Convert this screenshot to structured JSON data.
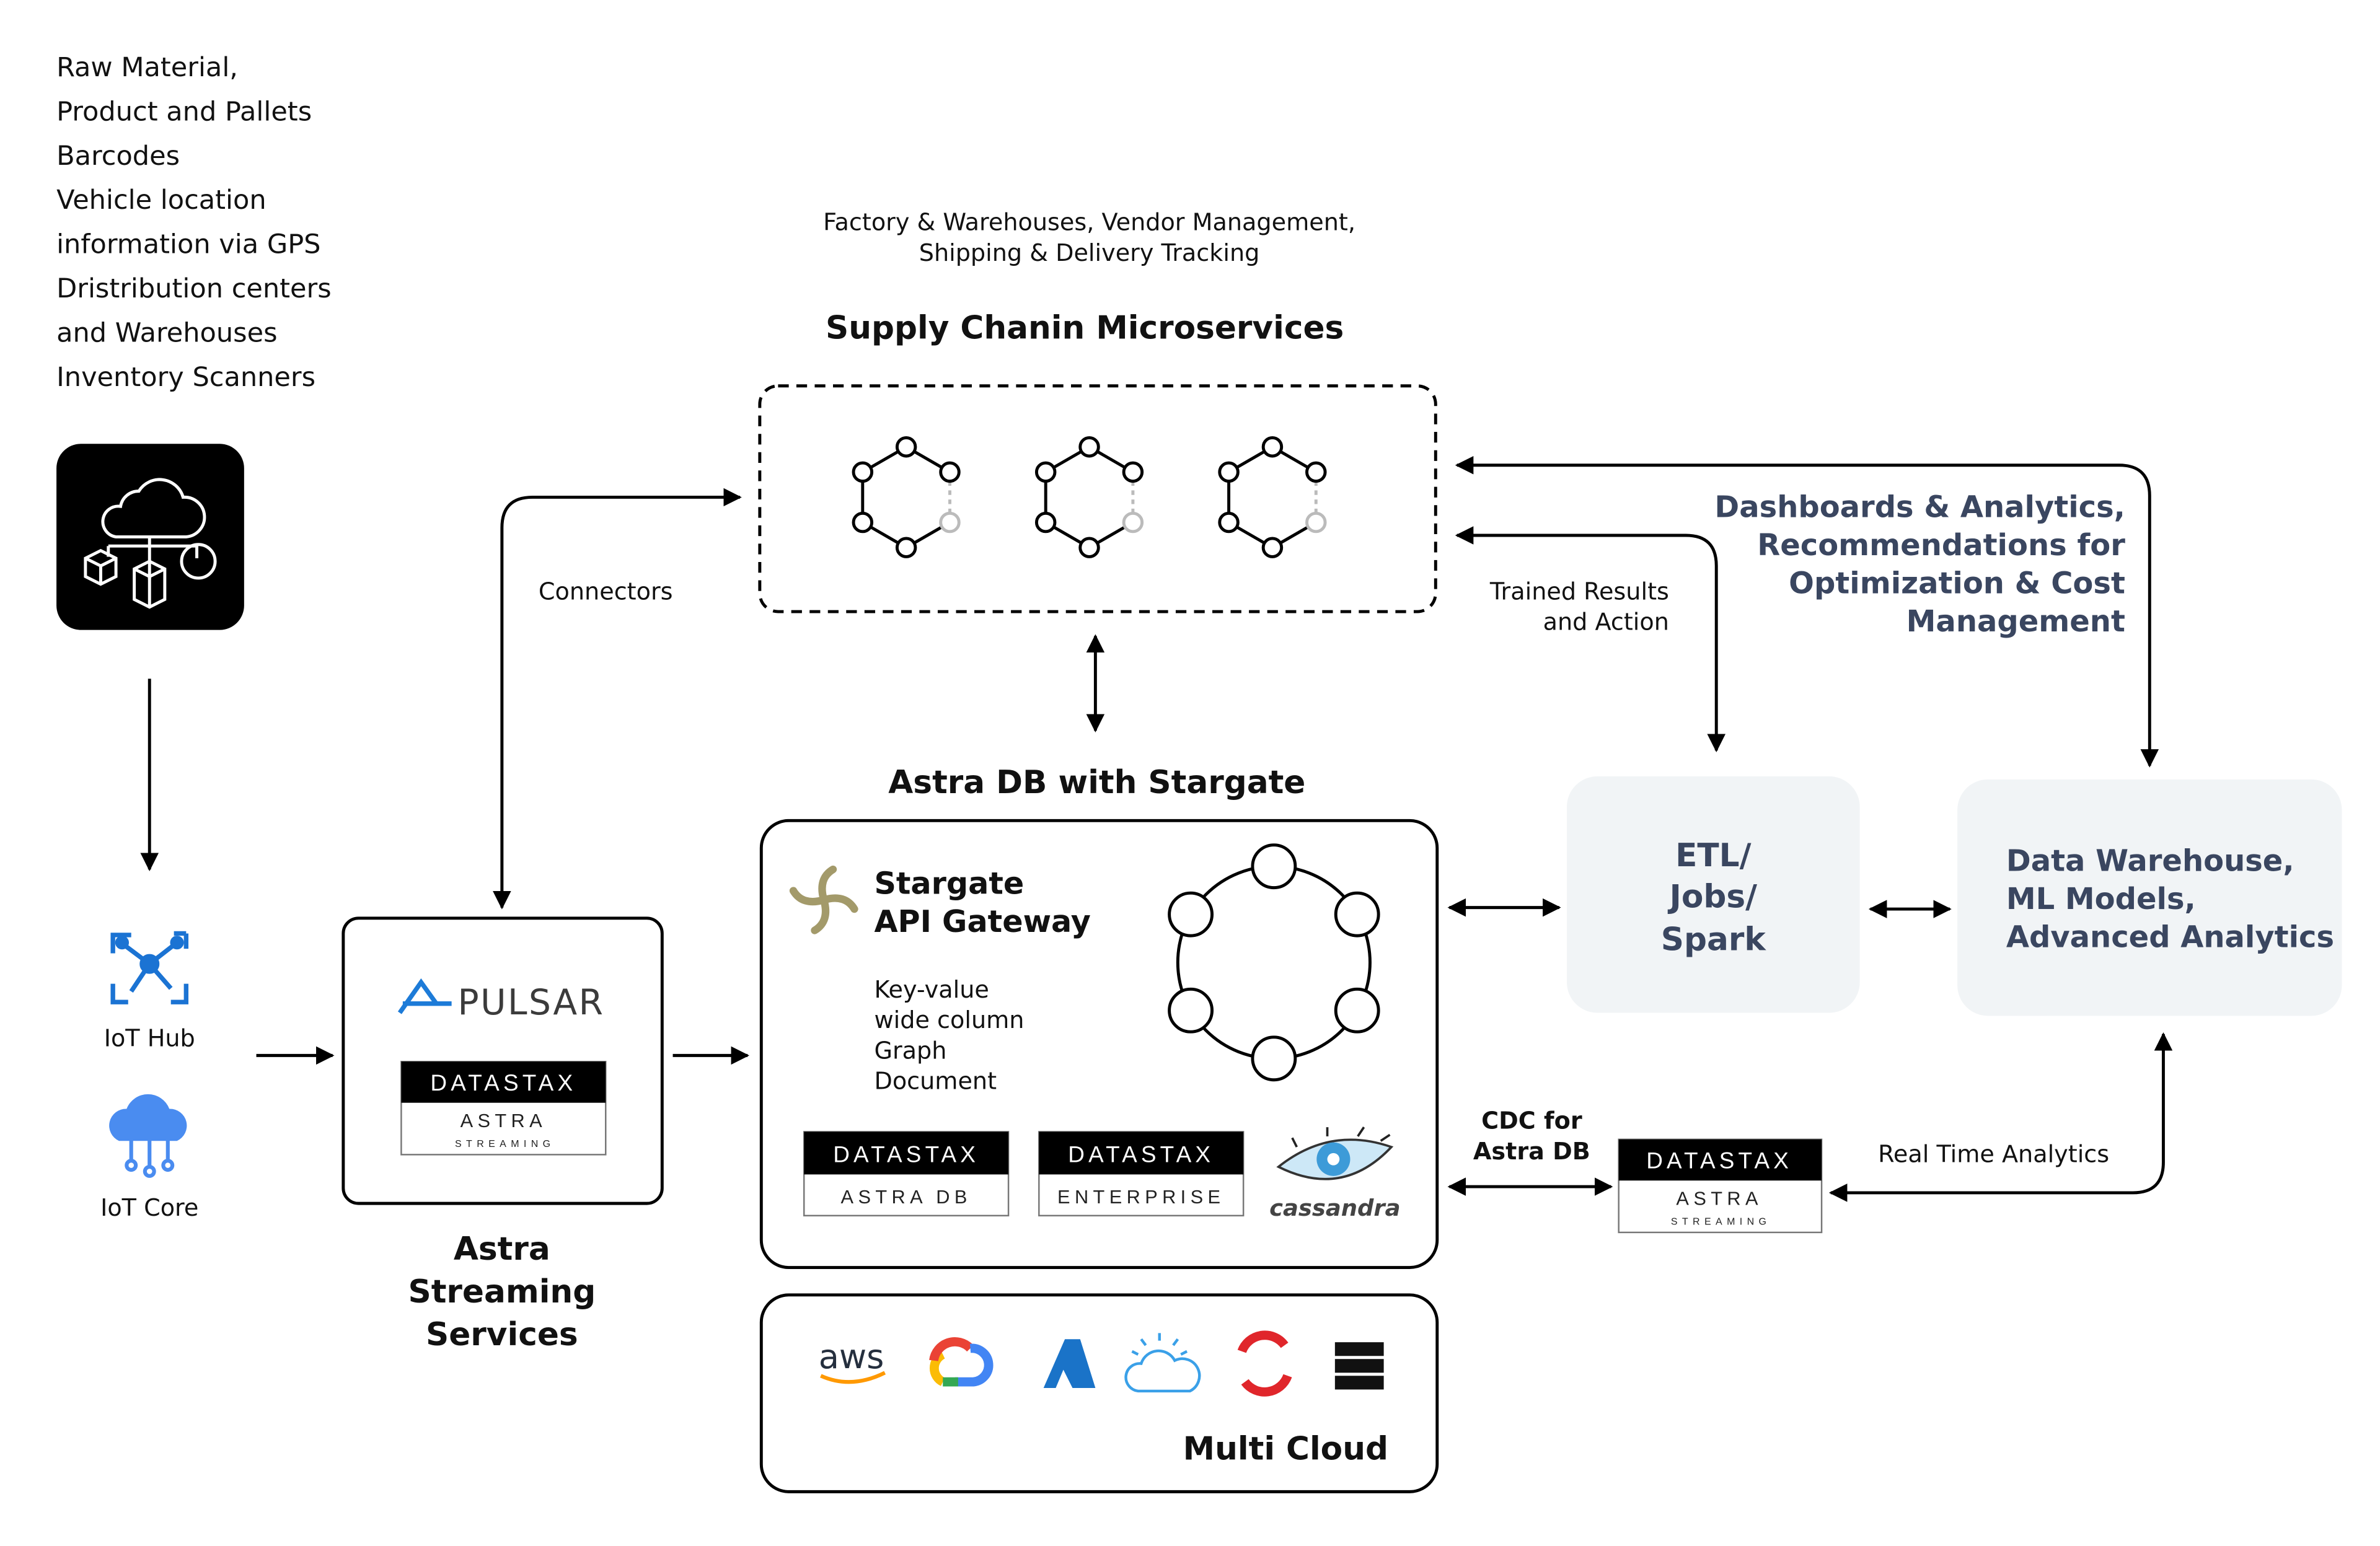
{
  "sources": {
    "lines": [
      "Raw Material,",
      "Product and Pallets",
      "Barcodes",
      "Vehicle location",
      "information via GPS",
      "Dristribution centers",
      "and Warehouses",
      "Inventory Scanners"
    ],
    "iot_hub_label": "IoT Hub",
    "iot_core_label": "IoT Core"
  },
  "streaming": {
    "pulsar_label": "PULSAR",
    "badge_brand": "DATASTAX",
    "badge_product": "ASTRA",
    "badge_sub": "STREAMING",
    "title_lines": [
      "Astra",
      "Streaming",
      "Services"
    ],
    "connectors_label": "Connectors"
  },
  "microservices": {
    "caption_lines": [
      "Factory & Warehouses, Vendor Management,",
      "Shipping & Delivery Tracking"
    ],
    "title": "Supply Chanin Microservices"
  },
  "astra_db": {
    "title": "Astra DB with Stargate",
    "gateway_lines": [
      "Stargate",
      "API Gateway"
    ],
    "models": [
      "Key-value",
      "wide column",
      "Graph",
      "Document"
    ],
    "badges": [
      {
        "brand": "DATASTAX",
        "product": "ASTRA DB"
      },
      {
        "brand": "DATASTAX",
        "product": "ENTERPRISE"
      }
    ],
    "cassandra_label": "cassandra"
  },
  "multi_cloud": {
    "title": "Multi Cloud",
    "aws_label": "aws",
    "icons": [
      "aws-icon",
      "google-cloud-icon",
      "azure-icon",
      "ibm-cloud-icon",
      "openshift-icon",
      "on-prem-server-icon"
    ]
  },
  "etl": {
    "lines": [
      "ETL/",
      "Jobs/",
      "Spark"
    ]
  },
  "warehouse": {
    "lines": [
      "Data Warehouse,",
      "ML Models,",
      "Advanced Analytics"
    ]
  },
  "flows": {
    "trained_lines": [
      "Trained Results",
      "and Action"
    ],
    "dashboards_lines": [
      "Dashboards & Analytics,",
      "Recommendations for",
      "Optimization & Cost",
      "Management"
    ],
    "cdc_lines": [
      "CDC for",
      "Astra DB"
    ],
    "cdc_badge": {
      "brand": "DATASTAX",
      "product": "ASTRA",
      "sub": "STREAMING"
    },
    "realtime_label": "Real Time Analytics"
  },
  "colors": {
    "panel_fill": "#f1f4f6",
    "accent_text": "#3a4660",
    "stargate": "#a39a6a"
  }
}
